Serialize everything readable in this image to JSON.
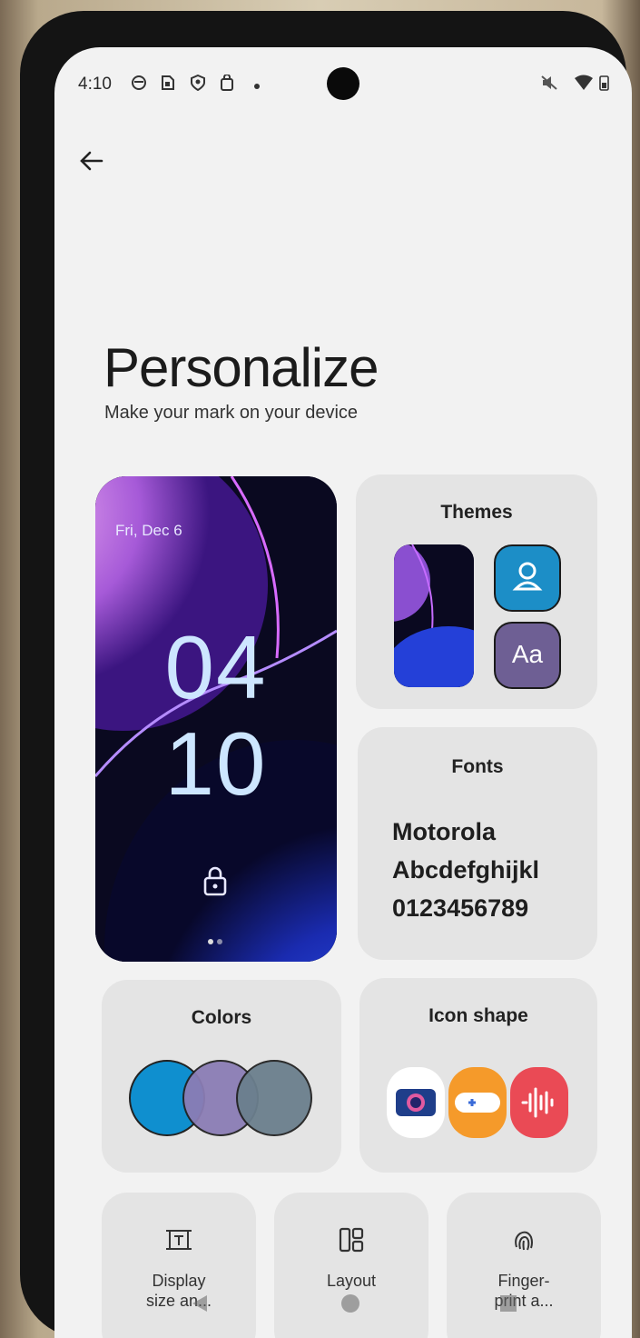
{
  "status_bar": {
    "time": "4:10"
  },
  "header": {
    "title": "Personalize",
    "subtitle": "Make your mark on your device"
  },
  "lock_screen_preview": {
    "date": "Fri, Dec 6",
    "hour": "04",
    "minute": "10"
  },
  "cards": {
    "themes": {
      "title": "Themes"
    },
    "fonts": {
      "title": "Fonts",
      "sample_lines": [
        "Motorola",
        "Abcdefghijkl",
        "0123456789"
      ]
    },
    "colors": {
      "title": "Colors",
      "swatches": [
        "#0f8fcf",
        "#8b7db5",
        "#6b7f8d"
      ]
    },
    "icon_shape": {
      "title": "Icon shape"
    }
  },
  "tiles": [
    {
      "label_line1": "Display",
      "label_line2": "size an...",
      "icon": "display-size-icon"
    },
    {
      "label_line1": "Layout",
      "label_line2": "",
      "icon": "layout-icon"
    },
    {
      "label_line1": "Finger-",
      "label_line2": "print a...",
      "icon": "fingerprint-icon"
    }
  ],
  "colors": {
    "theme_blue": "#1c8ec7",
    "theme_purple": "#6e5f94"
  }
}
